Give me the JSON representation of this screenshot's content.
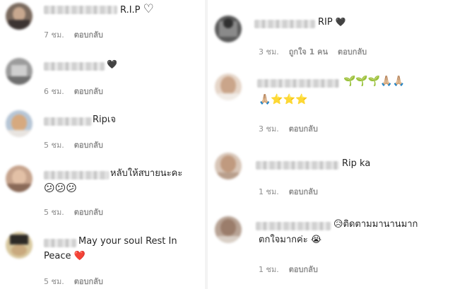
{
  "reply_label": "ตอบกลับ",
  "left_comments": [
    {
      "text": "R.I.P",
      "emoji": "♡",
      "time": "7 ชม."
    },
    {
      "text": "",
      "emoji": "🖤",
      "time": "6 ชม."
    },
    {
      "text": "Ripเจ",
      "emoji": "",
      "time": "5 ชม."
    },
    {
      "text": "หลับให้สบายนะคะ",
      "emoji": "",
      "line2": "😕😕😕",
      "time": "5 ชม."
    },
    {
      "text": "May your soul Rest In",
      "emoji": "",
      "line2": "Peace ❤️",
      "time": "5 ชม."
    }
  ],
  "right_comments": [
    {
      "text": "RIP",
      "emoji": "🖤",
      "time": "3 ชม.",
      "likes": "ถูกใจ 1 คน"
    },
    {
      "text": "",
      "emoji": "🌱🌱🌱🙏🏼🙏🏼",
      "line2": "🙏🏼⭐⭐⭐",
      "time": "3 ชม."
    },
    {
      "text": "Rip ka",
      "emoji": "",
      "time": "1 ชม."
    },
    {
      "text": "😥ติดตามมานานมาก",
      "emoji": "",
      "line2": "ตกใจมากค่ะ 😭",
      "time": "1 ชม."
    }
  ]
}
